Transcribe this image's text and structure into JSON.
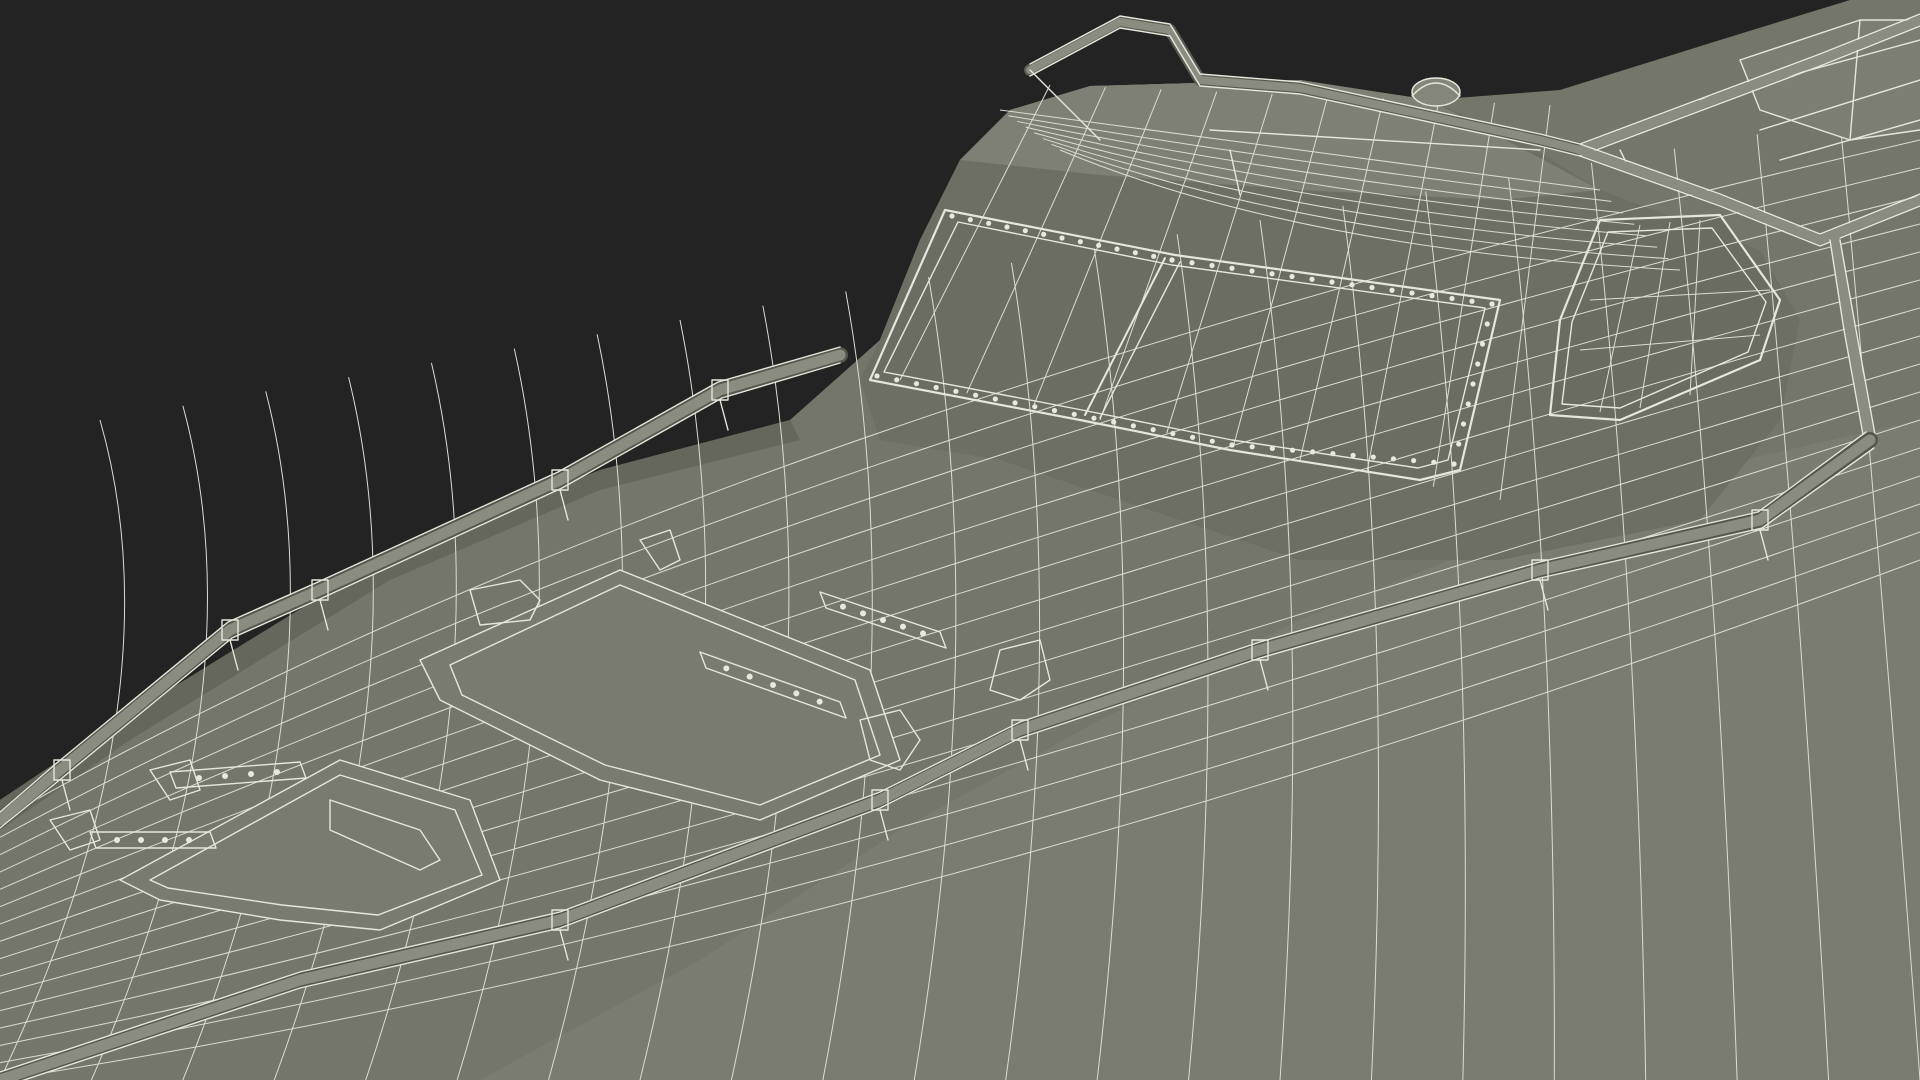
{
  "scene": {
    "subject": "",
    "render_mode": "wireframe-over-shaded",
    "colors": {
      "background": "#232323",
      "hull_fill": "#75766a",
      "hull_dark": "#5f6056",
      "hull_light": "#85867a",
      "wire": "#e6e6dc"
    }
  }
}
